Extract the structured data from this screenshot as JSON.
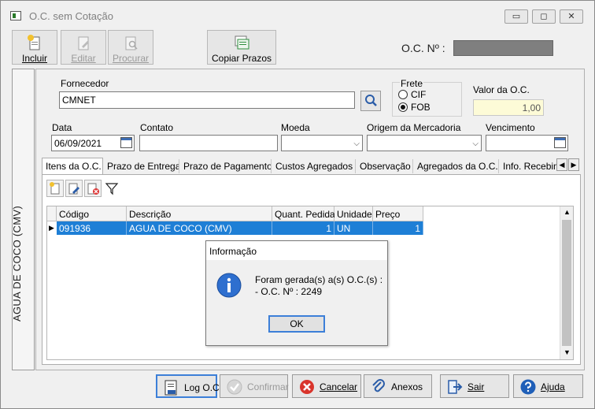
{
  "window": {
    "title": "O.C. sem Cotação",
    "minimize": "▭",
    "maximize": "◻",
    "close": "✕"
  },
  "toolbar": {
    "incluir": "Incluir",
    "editar": "Editar",
    "procurar": "Procurar",
    "copiar_prazos": "Copiar Prazos"
  },
  "oc": {
    "label": "O.C. Nº :",
    "value": ""
  },
  "side_label": "AGUA DE COCO (CMV)",
  "fornecedor": {
    "label": "Fornecedor",
    "value": "CMNET"
  },
  "frete": {
    "label": "Frete",
    "cif": "CIF",
    "fob": "FOB",
    "selected": "FOB"
  },
  "valor_oc": {
    "label": "Valor da O.C.",
    "value": "1,00",
    "bg": "#fdfbd7"
  },
  "data": {
    "label": "Data",
    "value": "06/09/2021"
  },
  "contato": {
    "label": "Contato",
    "value": ""
  },
  "moeda": {
    "label": "Moeda",
    "value": ""
  },
  "origem": {
    "label": "Origem da Mercadoria",
    "value": ""
  },
  "vencimento": {
    "label": "Vencimento",
    "value": ""
  },
  "tabs": [
    "Itens da O.C.",
    "Prazo de Entrega",
    "Prazo de Pagamento",
    "Custos Agregados",
    "Observação",
    "Agregados da O.C.",
    "Info. Recebim"
  ],
  "grid": {
    "columns": [
      "Código",
      "Descrição",
      "Quant. Pedida",
      "Unidade",
      "Preço"
    ],
    "rows": [
      {
        "codigo": "091936",
        "descricao": "AGUA DE COCO (CMV)",
        "quant": "1",
        "unidade": "UN",
        "preco": "1"
      }
    ],
    "selection_color": "#1e7fd6"
  },
  "dialog": {
    "title": "Informação",
    "line1": "Foram gerada(s) a(s) O.C.(s) :",
    "line2": "- O.C. Nº : 2249",
    "ok": "OK"
  },
  "buttons": {
    "log": "Log O.C",
    "confirmar": "Confirmar",
    "cancelar": "Cancelar",
    "anexos": "Anexos",
    "sair": "Sair",
    "ajuda": "Ajuda"
  }
}
